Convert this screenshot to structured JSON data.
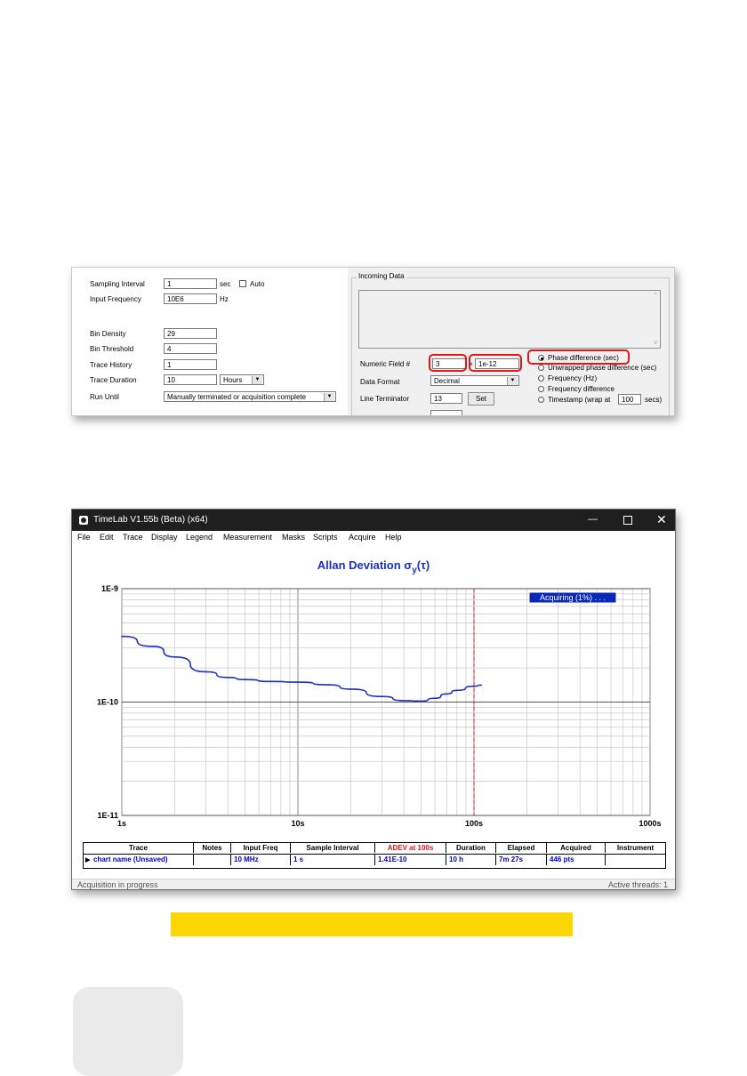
{
  "settings_dialog": {
    "sampling_interval": {
      "label": "Sampling Interval",
      "value": "1",
      "unit": "sec",
      "auto_label": "Auto"
    },
    "input_frequency": {
      "label": "Input Frequency",
      "value": "10E6",
      "unit": "Hz"
    },
    "bin_density": {
      "label": "Bin Density",
      "value": "29"
    },
    "bin_threshold": {
      "label": "Bin Threshold",
      "value": "4"
    },
    "trace_history": {
      "label": "Trace History",
      "value": "1"
    },
    "trace_duration": {
      "label": "Trace Duration",
      "value": "10",
      "unit_selected": "Hours"
    },
    "run_until": {
      "label": "Run Until",
      "selected": "Manually terminated or acquisition complete"
    },
    "incoming_data": {
      "title": "Incoming Data"
    },
    "numeric_field": {
      "label": "Numeric Field #",
      "value": "3",
      "scale": "1e-12"
    },
    "data_format": {
      "label": "Data Format",
      "selected": "Decimal"
    },
    "line_terminator": {
      "label": "Line Terminator",
      "value": "13",
      "set_label": "Set"
    },
    "data_types": [
      {
        "label": "Phase difference (sec)",
        "selected": true
      },
      {
        "label": "Unwrapped phase difference (sec)",
        "selected": false
      },
      {
        "label": "Frequency (Hz)",
        "selected": false
      },
      {
        "label": "Frequency difference",
        "selected": false
      },
      {
        "label": "Timestamp (wrap at",
        "selected": false
      }
    ],
    "timestamp_wrap_value": "100",
    "timestamp_wrap_unit": "secs)",
    "highlight_color": "#e0161b"
  },
  "timelab": {
    "window_title": "TimeLab V1.55b (Beta) (x64)",
    "menu": [
      "File",
      "Edit",
      "Trace",
      "Display",
      "Legend",
      "Measurement",
      "Masks",
      "Scripts",
      "Acquire",
      "Help"
    ],
    "status_left": "Acquisition in progress",
    "status_right": "Active threads: 1",
    "acquiring_badge": "Acquiring (1%) . . .",
    "trace_table": {
      "headers": [
        "Trace",
        "Notes",
        "Input Freq",
        "Sample Interval",
        "ADEV at 100s",
        "Duration",
        "Elapsed",
        "Acquired",
        "Instrument"
      ],
      "row": [
        "chart name (Unsaved)",
        "",
        "10 MHz",
        "1 s",
        "1.41E-10",
        "10 h",
        "7m 27s",
        "446 pts",
        ""
      ]
    },
    "colors": {
      "trace": "#1a2fc8",
      "accent_red": "#e0161b",
      "value_blue": "#0000c0"
    }
  },
  "chart_data": {
    "type": "line",
    "title": "Allan Deviation σy(τ)",
    "title_main": "Allan Deviation σ",
    "title_sub": "y",
    "title_suffix": "(τ)",
    "x_scale": "log",
    "y_scale": "log",
    "xlim": [
      1,
      1000
    ],
    "ylim": [
      1e-11,
      1e-09
    ],
    "x_tick_labels": [
      "1s",
      "10s",
      "100s",
      "1000s"
    ],
    "y_tick_labels": [
      "1E-9",
      "1E-10",
      "1E-11"
    ],
    "grid": true,
    "marker_line_x": 100,
    "series": [
      {
        "x": [
          1,
          1.5,
          2,
          3,
          4,
          5,
          7,
          10,
          15,
          20,
          30,
          40,
          50,
          60,
          70,
          80,
          100,
          110
        ],
        "y": [
          3.8e-10,
          3.1e-10,
          2.5e-10,
          1.85e-10,
          1.65e-10,
          1.58e-10,
          1.52e-10,
          1.5e-10,
          1.42e-10,
          1.3e-10,
          1.12e-10,
          1.03e-10,
          1.02e-10,
          1.08e-10,
          1.18e-10,
          1.27e-10,
          1.38e-10,
          1.41e-10
        ]
      }
    ]
  }
}
